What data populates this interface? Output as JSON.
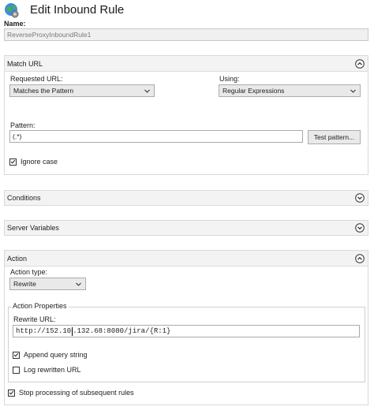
{
  "page": {
    "title": "Edit Inbound Rule",
    "icon": "globe-gear-icon"
  },
  "name_field": {
    "label": "Name:",
    "value": "ReverseProxyInboundRule1"
  },
  "match_url": {
    "header": "Match URL",
    "requested_url_label": "Requested URL:",
    "requested_url_value": "Matches the Pattern",
    "using_label": "Using:",
    "using_value": "Regular Expressions",
    "pattern_label": "Pattern:",
    "pattern_value": "(.*)",
    "test_pattern_button": "Test pattern...",
    "ignore_case_label": "Ignore case",
    "ignore_case_checked": true
  },
  "conditions": {
    "header": "Conditions"
  },
  "server_variables": {
    "header": "Server Variables"
  },
  "action": {
    "header": "Action",
    "action_type_label": "Action type:",
    "action_type_value": "Rewrite",
    "properties_legend": "Action Properties",
    "rewrite_url_label": "Rewrite URL:",
    "rewrite_url_part1": "http://152.10",
    "rewrite_url_part2": ".132.68:8080/jira/",
    "rewrite_url_part3": "{R:1}",
    "append_query_label": "Append query string",
    "append_query_checked": true,
    "log_rewritten_label": "Log rewritten URL",
    "log_rewritten_checked": false,
    "stop_processing_label": "Stop processing of subsequent rules",
    "stop_processing_checked": true
  },
  "colors": {
    "accent_text": "#1e1e1e",
    "panel_header": "#f3f3f3",
    "disabled_text": "#7a7a7a"
  }
}
